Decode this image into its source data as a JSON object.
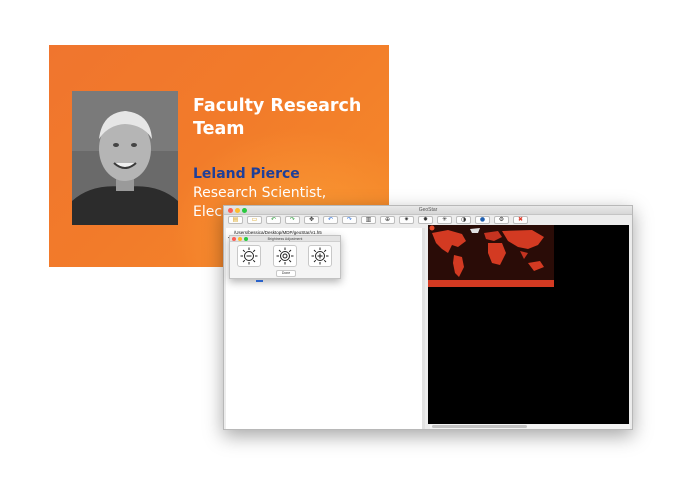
{
  "slide": {
    "title": "Faculty Research Team",
    "name": "Leland Pierce",
    "role_line1": "Research Scientist,",
    "role_line2_partial": "Elec"
  },
  "window": {
    "title": "GeoStar",
    "file_path": "/Users/bessica/Desktop/MDP/geoStar/v1.h5"
  },
  "toolbar": {
    "buttons": [
      {
        "name": "open-file-button",
        "glyph": "📂",
        "color": "#d9a11a"
      },
      {
        "name": "folder-button",
        "glyph": "▭",
        "color": "#d9a11a"
      },
      {
        "name": "undo-green-button",
        "glyph": "↶",
        "color": "#2c9c3a"
      },
      {
        "name": "redo-green-button",
        "glyph": "↷",
        "color": "#2c9c3a"
      },
      {
        "name": "move-button",
        "glyph": "✥",
        "color": "#333333"
      },
      {
        "name": "undo-button",
        "glyph": "↶",
        "color": "#2a6fdb"
      },
      {
        "name": "redo-button",
        "glyph": "↷",
        "color": "#2a6fdb"
      },
      {
        "name": "book-button",
        "glyph": "▥",
        "color": "#333333"
      },
      {
        "name": "crosshair-button",
        "glyph": "⊕",
        "color": "#999999"
      },
      {
        "name": "brightness-up-button",
        "glyph": "✷",
        "color": "#333333"
      },
      {
        "name": "brightness-button",
        "glyph": "✸",
        "color": "#333333"
      },
      {
        "name": "brightness-down-button",
        "glyph": "✳",
        "color": "#333333"
      },
      {
        "name": "contrast-button",
        "glyph": "◑",
        "color": "#333333"
      },
      {
        "name": "saturation-button",
        "glyph": "💧",
        "color": "#1f5fb0"
      },
      {
        "name": "settings-button",
        "glyph": "⚙",
        "color": "#333333"
      },
      {
        "name": "stop-button",
        "glyph": "✖",
        "color": "#e03a2a"
      }
    ]
  },
  "dialog": {
    "title": "Brightness Adjustment",
    "done_label": "Done",
    "buttons": [
      "brightness-decrease",
      "brightness-reset",
      "brightness-increase"
    ]
  },
  "colors": {
    "slide_orange": "#f27b2a",
    "name_blue": "#1f3f99",
    "map_red": "#d33a22",
    "map_ocean": "#2a0c07"
  }
}
